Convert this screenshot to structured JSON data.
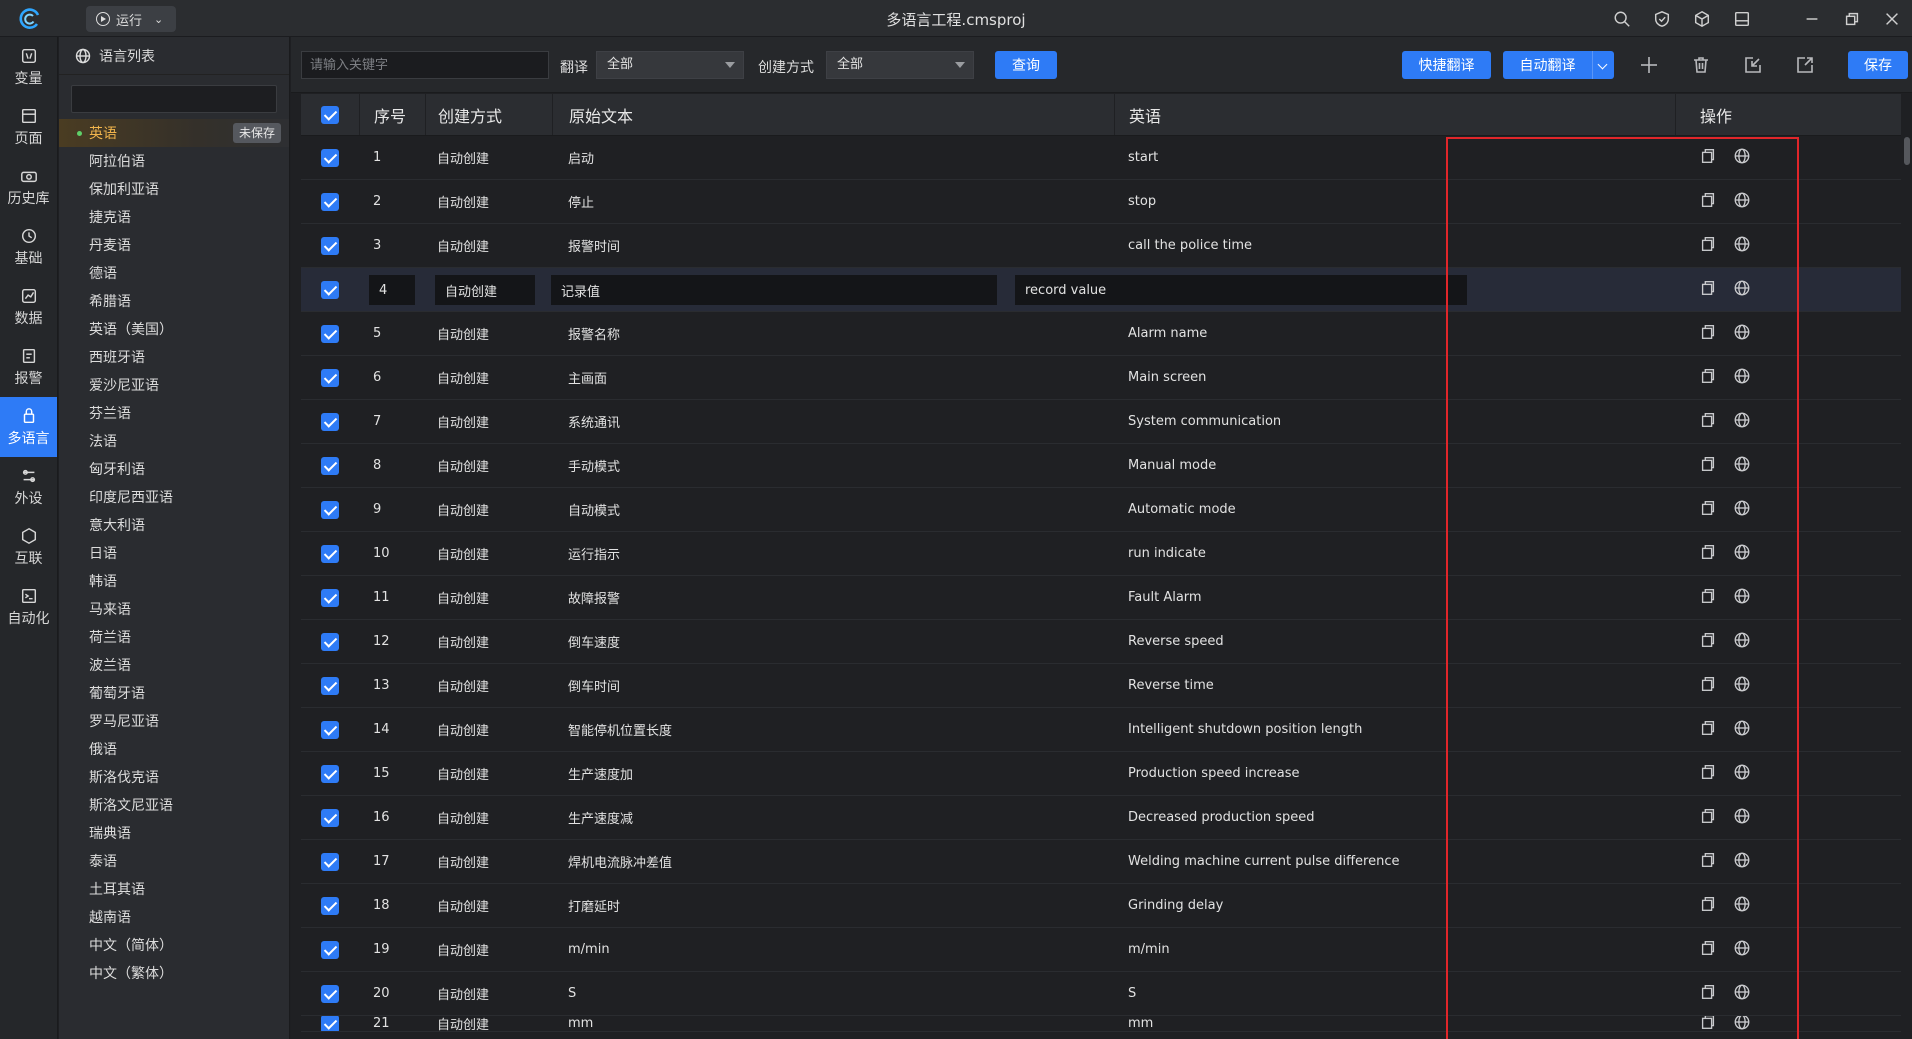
{
  "window": {
    "title": "多语言工程.cmsproj",
    "run_label": "运行"
  },
  "rail": {
    "items": [
      {
        "label": "变量",
        "icon": "variable-icon",
        "active": false
      },
      {
        "label": "页面",
        "icon": "page-icon",
        "active": false
      },
      {
        "label": "历史库",
        "icon": "history-icon",
        "active": false
      },
      {
        "label": "基础",
        "icon": "basic-icon",
        "active": false
      },
      {
        "label": "数据",
        "icon": "data-icon",
        "active": false
      },
      {
        "label": "报警",
        "icon": "alarm-icon",
        "active": false
      },
      {
        "label": "多语言",
        "icon": "language-icon",
        "active": true
      },
      {
        "label": "外设",
        "icon": "peripheral-icon",
        "active": false
      },
      {
        "label": "互联",
        "icon": "interconnect-icon",
        "active": false
      },
      {
        "label": "自动化",
        "icon": "automation-icon",
        "active": false
      }
    ]
  },
  "language_panel": {
    "title": "语言列表",
    "unsaved_badge": "未保存",
    "languages": [
      "英语",
      "阿拉伯语",
      "保加利亚语",
      "捷克语",
      "丹麦语",
      "德语",
      "希腊语",
      "英语（美国）",
      "西班牙语",
      "爱沙尼亚语",
      "芬兰语",
      "法语",
      "匈牙利语",
      "印度尼西亚语",
      "意大利语",
      "日语",
      "韩语",
      "马来语",
      "荷兰语",
      "波兰语",
      "葡萄牙语",
      "罗马尼亚语",
      "俄语",
      "斯洛伐克语",
      "斯洛文尼亚语",
      "瑞典语",
      "泰语",
      "土耳其语",
      "越南语",
      "中文（简体）",
      "中文（繁体）"
    ]
  },
  "toolbar": {
    "keyword_placeholder": "请输入关键字",
    "translate_label": "翻译",
    "translate_value": "全部",
    "create_mode_label": "创建方式",
    "create_mode_value": "全部",
    "query_label": "查询",
    "quick_translate_label": "快捷翻译",
    "auto_translate_label": "自动翻译",
    "save_label": "保存"
  },
  "table": {
    "headers": {
      "no": "序号",
      "mode": "创建方式",
      "source": "原始文本",
      "english": "英语",
      "ops": "操作"
    },
    "selected_row": 4,
    "rows": [
      {
        "no": "1",
        "mode": "自动创建",
        "source": "启动",
        "english": "start"
      },
      {
        "no": "2",
        "mode": "自动创建",
        "source": "停止",
        "english": "stop"
      },
      {
        "no": "3",
        "mode": "自动创建",
        "source": "报警时间",
        "english": "call the police time"
      },
      {
        "no": "4",
        "mode": "自动创建",
        "source": "记录值",
        "english": "record value"
      },
      {
        "no": "5",
        "mode": "自动创建",
        "source": "报警名称",
        "english": "Alarm name"
      },
      {
        "no": "6",
        "mode": "自动创建",
        "source": "主画面",
        "english": "Main screen"
      },
      {
        "no": "7",
        "mode": "自动创建",
        "source": "系统通讯",
        "english": "System communication"
      },
      {
        "no": "8",
        "mode": "自动创建",
        "source": "手动模式",
        "english": "Manual mode"
      },
      {
        "no": "9",
        "mode": "自动创建",
        "source": "自动模式",
        "english": "Automatic mode"
      },
      {
        "no": "10",
        "mode": "自动创建",
        "source": "运行指示",
        "english": "run indicate"
      },
      {
        "no": "11",
        "mode": "自动创建",
        "source": "故障报警",
        "english": "Fault Alarm"
      },
      {
        "no": "12",
        "mode": "自动创建",
        "source": "倒车速度",
        "english": "Reverse speed"
      },
      {
        "no": "13",
        "mode": "自动创建",
        "source": "倒车时间",
        "english": "Reverse time"
      },
      {
        "no": "14",
        "mode": "自动创建",
        "source": "智能停机位置长度",
        "english": "Intelligent shutdown position length"
      },
      {
        "no": "15",
        "mode": "自动创建",
        "source": "生产速度加",
        "english": "Production speed increase"
      },
      {
        "no": "16",
        "mode": "自动创建",
        "source": "生产速度减",
        "english": "Decreased production speed"
      },
      {
        "no": "17",
        "mode": "自动创建",
        "source": "焊机电流脉冲差值",
        "english": "Welding machine current pulse difference"
      },
      {
        "no": "18",
        "mode": "自动创建",
        "source": "打磨延时",
        "english": "Grinding delay"
      },
      {
        "no": "19",
        "mode": "自动创建",
        "source": "m/min",
        "english": "m/min"
      },
      {
        "no": "20",
        "mode": "自动创建",
        "source": "S",
        "english": "S"
      },
      {
        "no": "21",
        "mode": "自动创建",
        "source": "mm",
        "english": "mm"
      }
    ]
  },
  "colors": {
    "accent": "#2e7bf6",
    "highlight_box": "#e0262a",
    "active_language": "#f0b44c"
  }
}
